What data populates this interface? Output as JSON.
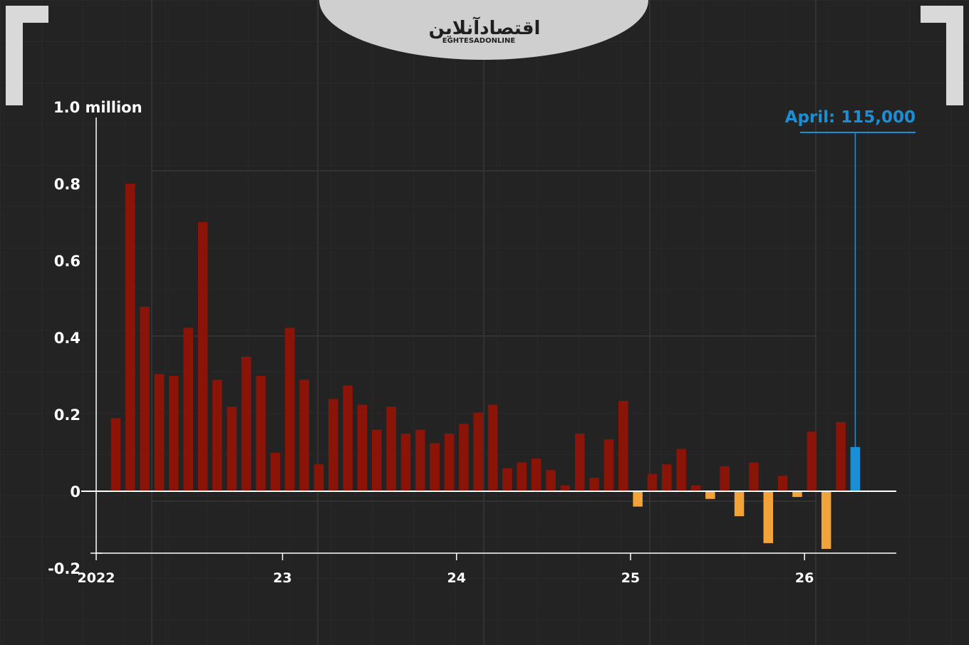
{
  "logo": {
    "text_fa": "اقتصادآنلاین",
    "text_en": "EGHTESADONLINE"
  },
  "colors": {
    "positive": "#8b1408",
    "negative": "#f2a33a",
    "highlight": "#1a8fd6",
    "background": "#232323"
  },
  "chart_data": {
    "type": "bar",
    "title": "",
    "ylabel": "",
    "ylim": [
      -0.2,
      1.0
    ],
    "y_ticks": [
      {
        "value": 1.0,
        "label": "1.0 million"
      },
      {
        "value": 0.8,
        "label": "0.8"
      },
      {
        "value": 0.6,
        "label": "0.6"
      },
      {
        "value": 0.4,
        "label": "0.4"
      },
      {
        "value": 0.2,
        "label": "0.2"
      },
      {
        "value": 0,
        "label": "0"
      },
      {
        "value": -0.2,
        "label": "-0.2"
      }
    ],
    "x_ticks": [
      {
        "index": 0,
        "label": "2022"
      },
      {
        "index": 12,
        "label": "23"
      },
      {
        "index": 24,
        "label": "24"
      },
      {
        "index": 36,
        "label": "25"
      },
      {
        "index": 48,
        "label": "26"
      }
    ],
    "values": [
      0.19,
      0.8,
      0.48,
      0.305,
      0.3,
      0.425,
      0.7,
      0.29,
      0.22,
      0.35,
      0.3,
      0.1,
      0.425,
      0.29,
      0.07,
      0.24,
      0.275,
      0.225,
      0.16,
      0.22,
      0.15,
      0.16,
      0.125,
      0.15,
      0.175,
      0.205,
      0.225,
      0.06,
      0.075,
      0.085,
      0.055,
      0.015,
      0.15,
      0.035,
      0.135,
      0.235,
      -0.04,
      0.045,
      0.07,
      0.11,
      0.015,
      -0.02,
      0.065,
      -0.065,
      0.075,
      -0.135,
      0.04,
      -0.015,
      0.155,
      -0.15,
      0.18,
      0.115
    ],
    "highlight_index": 51,
    "annotation": "April: 115,000"
  }
}
